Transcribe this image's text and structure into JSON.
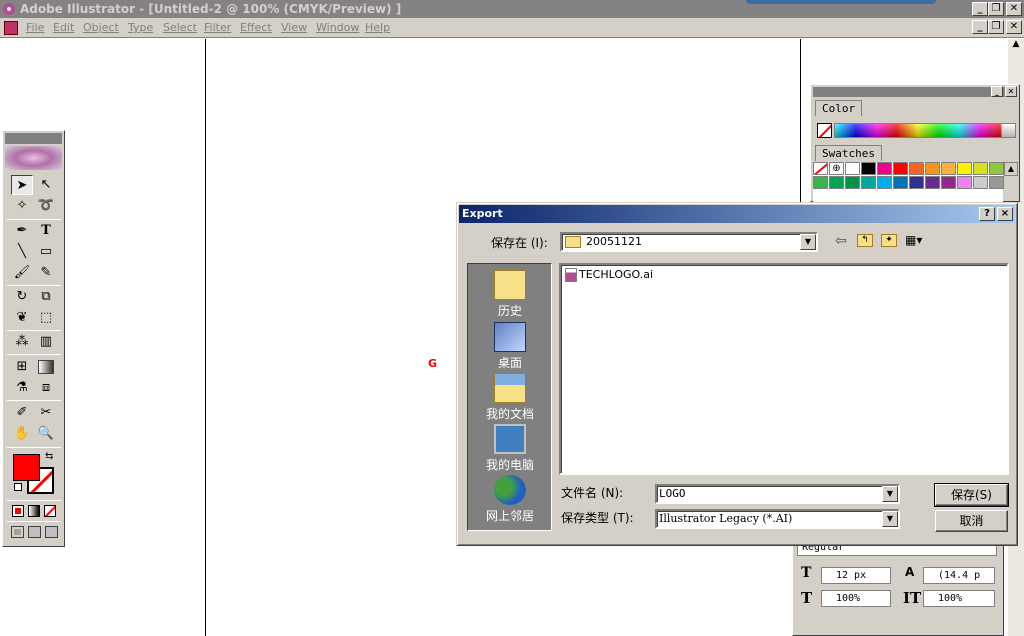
{
  "app": {
    "title": "Adobe Illustrator - [Untitled-2 @ 100% (CMYK/Preview) ]",
    "menu": [
      "File",
      "Edit",
      "Object",
      "Type",
      "Select",
      "Filter",
      "Effect",
      "View",
      "Window",
      "Help"
    ]
  },
  "panels": {
    "color_tab": "Color",
    "swatches_tab": "Swatches",
    "swatch_colors": [
      "#ffffff",
      "#000000",
      "#ec008c",
      "#ff0000",
      "#f26522",
      "#f7941d",
      "#fbb040",
      "#fff200",
      "#d7df23",
      "#8dc63f",
      "#39b54a",
      "#00a651",
      "#009444",
      "#00a99d",
      "#00aeef",
      "#0072bc",
      "#2e3192",
      "#662d91",
      "#92278f",
      "#ee82ee",
      "#cccccc",
      "#999999"
    ],
    "character": {
      "font_style": "Regular",
      "font_size": "12 px",
      "leading": "(14.4 p",
      "horiz_scale": "100%",
      "vert_scale": "100%"
    }
  },
  "dialog": {
    "title": "Export",
    "help_btn": "?",
    "close_btn": "×",
    "save_in_label": "保存在 (I):",
    "save_in_value": "20051121",
    "places": [
      {
        "label": "历史",
        "icon": "history-folder-icon"
      },
      {
        "label": "桌面",
        "icon": "desktop-icon"
      },
      {
        "label": "我的文档",
        "icon": "my-documents-icon"
      },
      {
        "label": "我的电脑",
        "icon": "my-computer-icon"
      },
      {
        "label": "网上邻居",
        "icon": "network-icon"
      }
    ],
    "files": [
      {
        "name": "TECHLOGO.ai"
      }
    ],
    "filename_label": "文件名 (N):",
    "filename_value": "LOGO",
    "filetype_label": "保存类型 (T):",
    "filetype_value": "Illustrator Legacy (*.AI)",
    "save_button": "保存(S)",
    "cancel_button": "取消"
  },
  "canvas": {
    "marker": "G"
  },
  "colors": {
    "fill_color": "#ff0000",
    "stroke_color": "#ffffff",
    "dialog_title_start": "#0a246a",
    "dialog_title_end": "#a6caf0"
  }
}
